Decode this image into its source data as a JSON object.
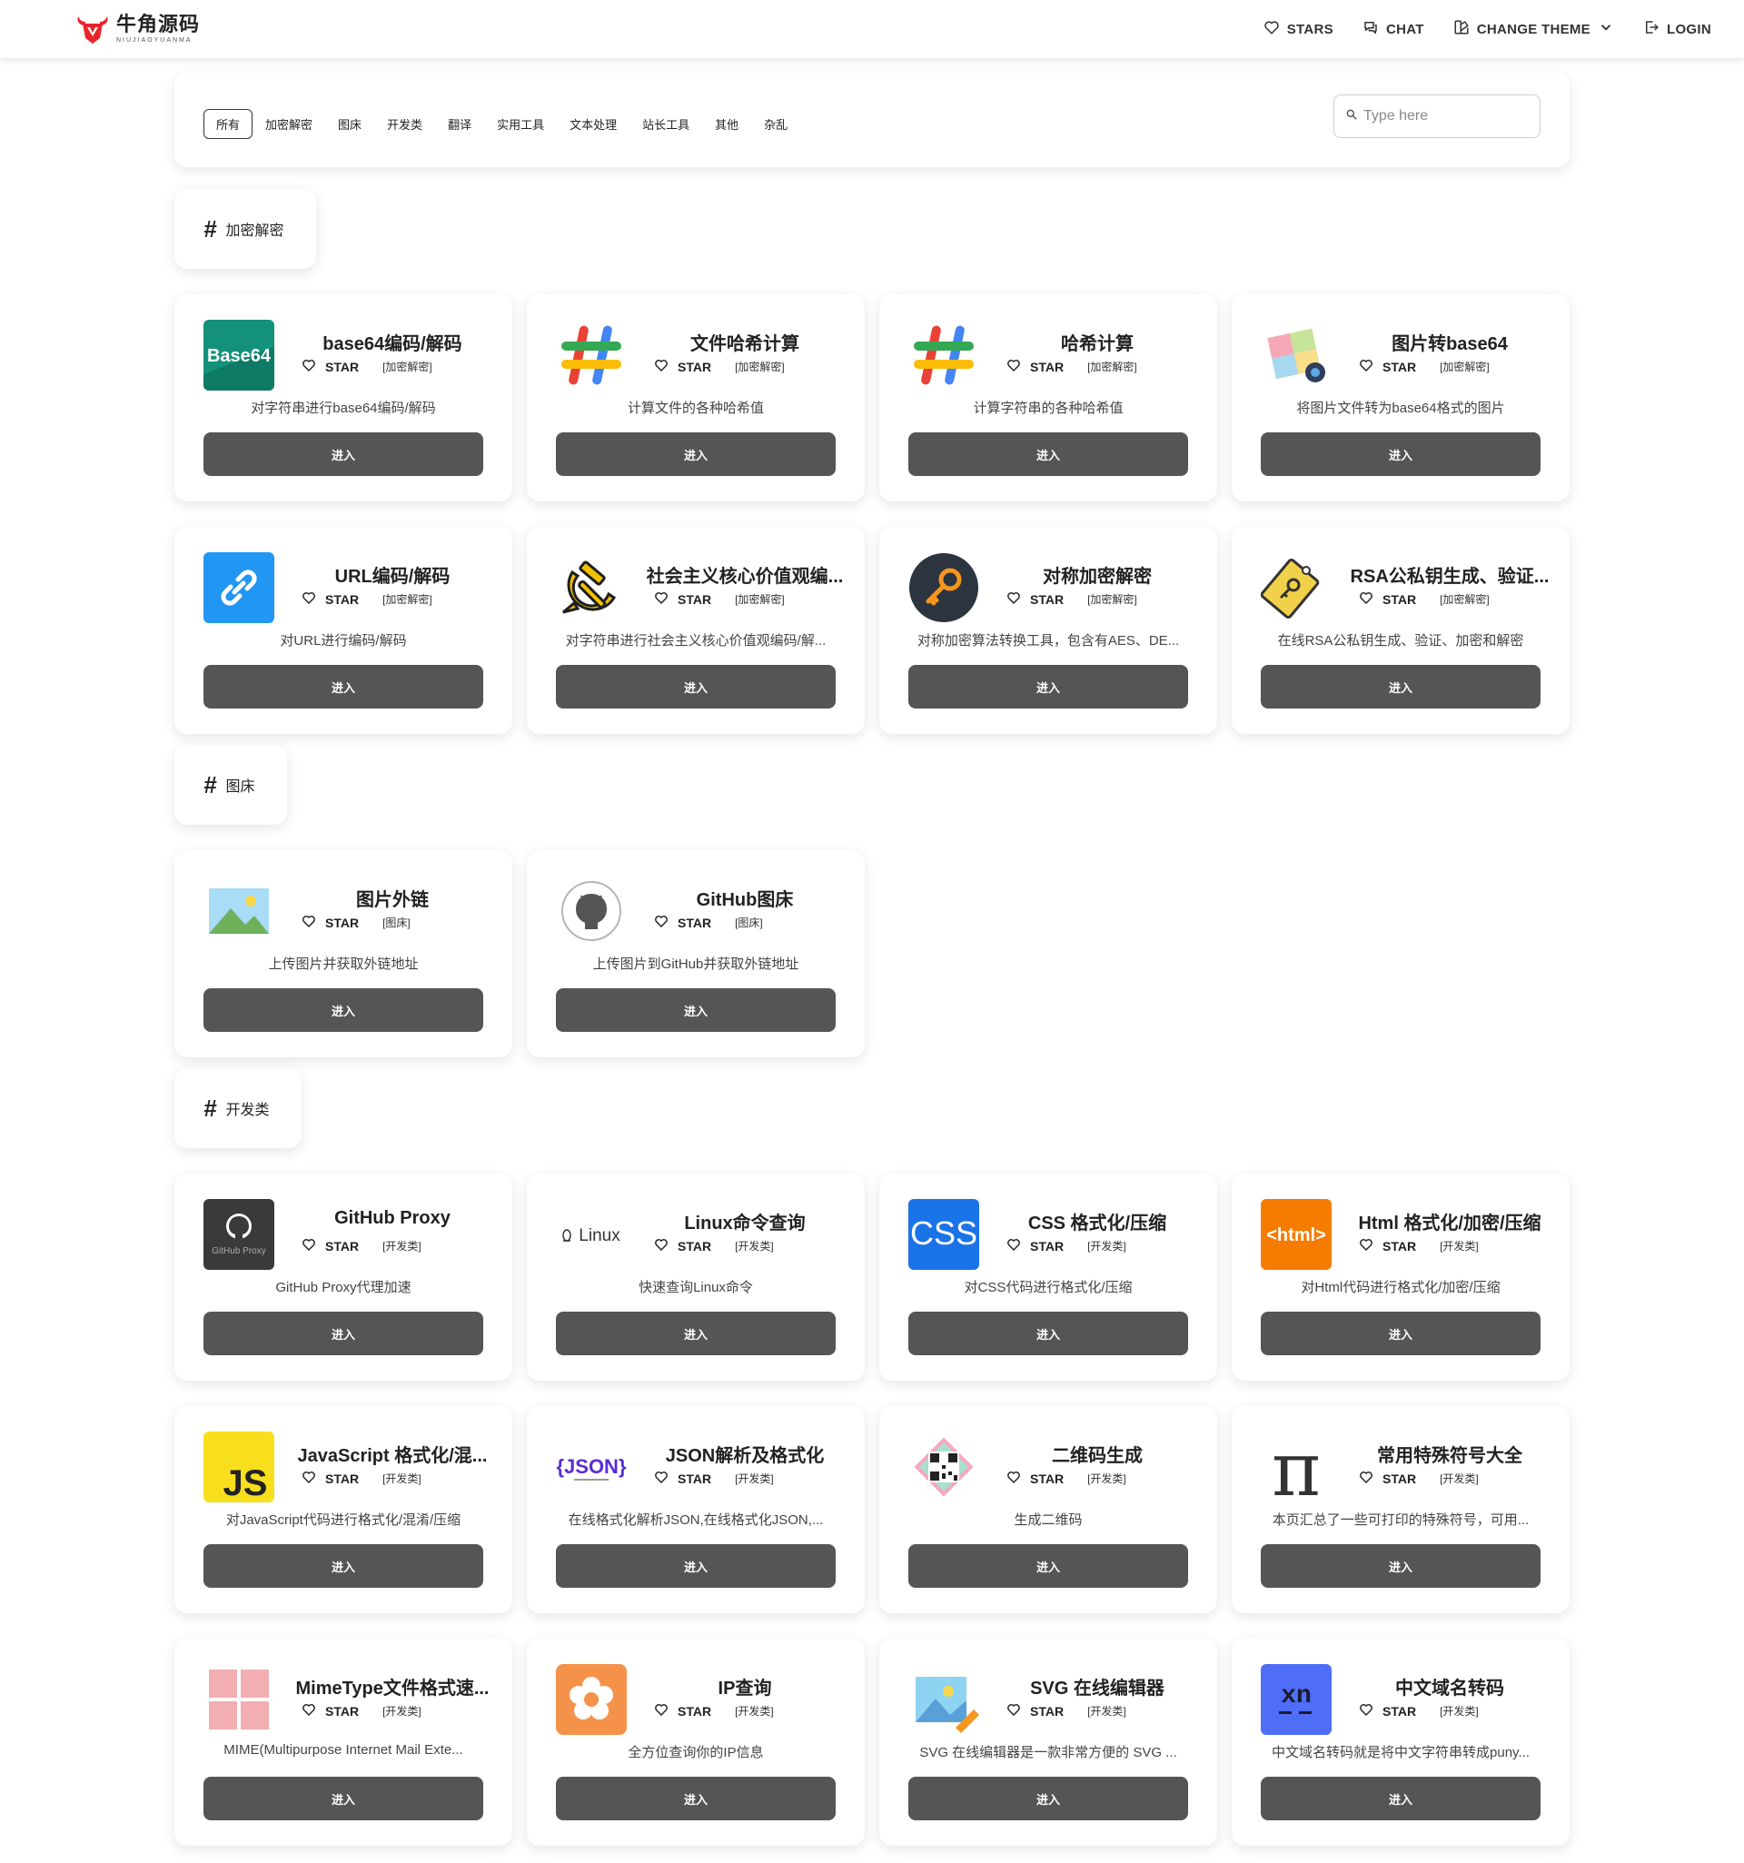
{
  "brand": {
    "name_cn": "牛角源码",
    "name_en": "NIUJIAOYUANMA"
  },
  "nav": {
    "stars": "STARS",
    "chat": "CHAT",
    "change_theme": "CHANGE THEME",
    "login": "LOGIN"
  },
  "filters": {
    "tabs": [
      "所有",
      "加密解密",
      "图床",
      "开发类",
      "翻译",
      "实用工具",
      "文本处理",
      "站长工具",
      "其他",
      "杂乱"
    ],
    "active_index": 0
  },
  "search": {
    "placeholder": "Type here"
  },
  "sections": [
    {
      "hash": "#",
      "label": "加密解密"
    },
    {
      "hash": "#",
      "label": "图床"
    },
    {
      "hash": "#",
      "label": "开发类"
    }
  ],
  "star_label": "STAR",
  "enter_label": "进入",
  "cards": [
    {
      "title": "base64编码/解码",
      "category": "[加密解密]",
      "desc": "对字符串进行base64编码/解码",
      "icon": "base64-icon"
    },
    {
      "title": "文件哈希计算",
      "category": "[加密解密]",
      "desc": "计算文件的各种哈希值",
      "icon": "hash-icon"
    },
    {
      "title": "哈希计算",
      "category": "[加密解密]",
      "desc": "计算字符串的各种哈希值",
      "icon": "hash-icon"
    },
    {
      "title": "图片转base64",
      "category": "[加密解密]",
      "desc": "将图片文件转为base64格式的图片",
      "icon": "image-base64-icon"
    },
    {
      "title": "URL编码/解码",
      "category": "[加密解密]",
      "desc": "对URL进行编码/解码",
      "icon": "link-icon"
    },
    {
      "title": "社会主义核心价值观编...",
      "category": "[加密解密]",
      "desc": "对字符串进行社会主义核心价值观编码/解...",
      "icon": "hammer-sickle-icon"
    },
    {
      "title": "对称加密解密",
      "category": "[加密解密]",
      "desc": "对称加密算法转换工具，包含有AES、DE...",
      "icon": "key-icon"
    },
    {
      "title": "RSA公私钥生成、验证...",
      "category": "[加密解密]",
      "desc": "在线RSA公私钥生成、验证、加密和解密",
      "icon": "key-tag-icon"
    },
    {
      "title": "图片外链",
      "category": "[图床]",
      "desc": "上传图片并获取外链地址",
      "icon": "picture-icon"
    },
    {
      "title": "GitHub图床",
      "category": "[图床]",
      "desc": "上传图片到GitHub并获取外链地址",
      "icon": "github-icon"
    },
    {
      "title": "GitHub Proxy",
      "category": "[开发类]",
      "desc": "GitHub Proxy代理加速",
      "icon": "github-proxy-icon",
      "icon_caption": "GitHub Proxy"
    },
    {
      "title": "Linux命令查询",
      "category": "[开发类]",
      "desc": "快速查询Linux命令",
      "icon": "linux-icon",
      "icon_caption": "Linux"
    },
    {
      "title": "CSS 格式化/压缩",
      "category": "[开发类]",
      "desc": "对CSS代码进行格式化/压缩",
      "icon": "css-icon",
      "icon_caption": "CSS"
    },
    {
      "title": "Html 格式化/加密/压缩",
      "category": "[开发类]",
      "desc": "对Html代码进行格式化/加密/压缩",
      "icon": "html-icon",
      "icon_caption": "<html>"
    },
    {
      "title": "JavaScript 格式化/混...",
      "category": "[开发类]",
      "desc": "对JavaScript代码进行格式化/混淆/压缩",
      "icon": "js-icon",
      "icon_caption": "JS"
    },
    {
      "title": "JSON解析及格式化",
      "category": "[开发类]",
      "desc": "在线格式化解析JSON,在线格式化JSON,...",
      "icon": "json-icon",
      "icon_caption": "{JSON}"
    },
    {
      "title": "二维码生成",
      "category": "[开发类]",
      "desc": "生成二维码",
      "icon": "qrcode-icon"
    },
    {
      "title": "常用特殊符号大全",
      "category": "[开发类]",
      "desc": "本页汇总了一些可打印的特殊符号，可用...",
      "icon": "pi-icon",
      "icon_caption": "π"
    },
    {
      "title": "MimeType文件格式速...",
      "category": "[开发类]",
      "desc": "MIME(Multipurpose Internet Mail Exte...",
      "icon": "mime-grid-icon"
    },
    {
      "title": "IP查询",
      "category": "[开发类]",
      "desc": "全方位查询你的IP信息",
      "icon": "flower-icon"
    },
    {
      "title": "SVG 在线编辑器",
      "category": "[开发类]",
      "desc": "SVG 在线编辑器是一款非常方便的 SVG ...",
      "icon": "svg-editor-icon"
    },
    {
      "title": "中文域名转码",
      "category": "[开发类]",
      "desc": "中文域名转码就是将中文字符串转成puny...",
      "icon": "xn-icon",
      "icon_caption": "xn"
    }
  ],
  "colors": {
    "button_bg": "#555555",
    "brand_red": "#e8242a",
    "link_blue": "#2196f3",
    "css_blue": "#1572b6",
    "html_orange": "#f16529",
    "js_yellow": "#f7df1e",
    "xn_blue": "#4f6ef7"
  }
}
